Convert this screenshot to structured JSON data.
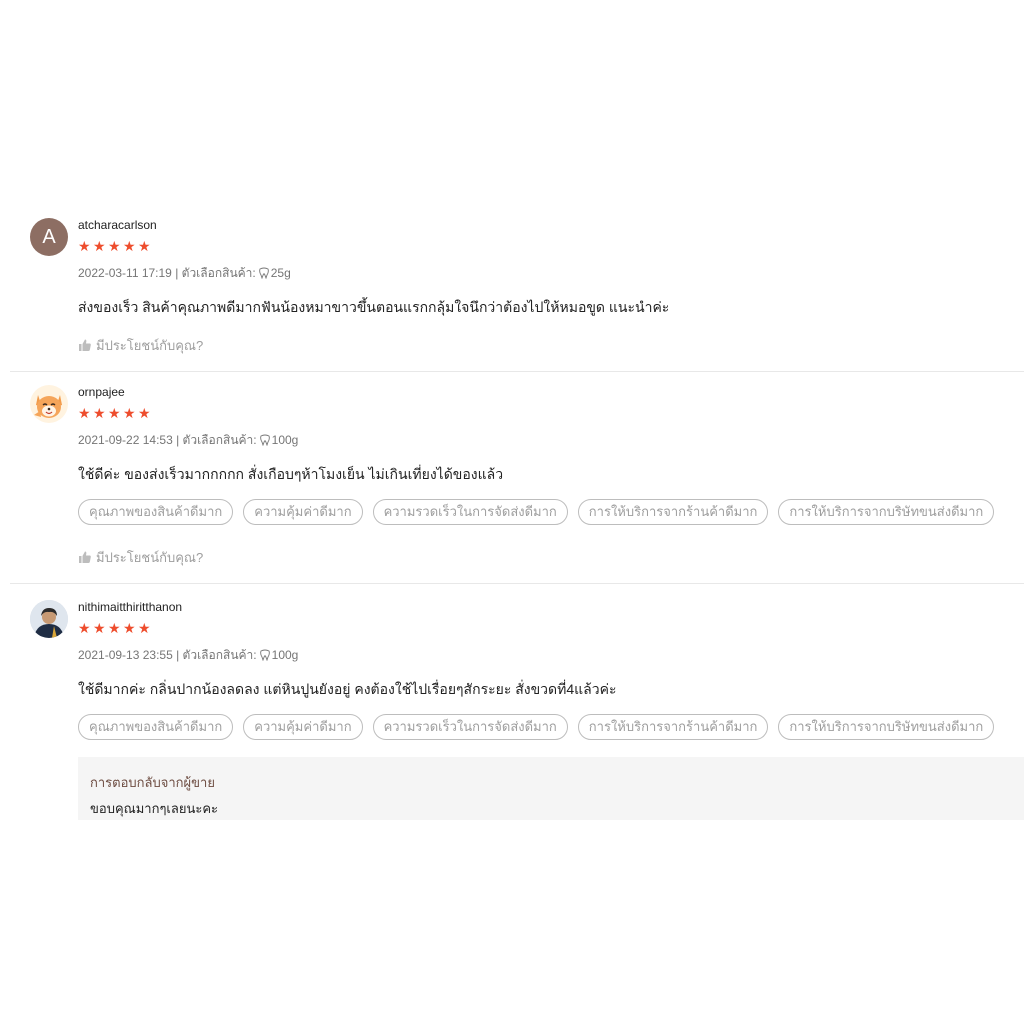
{
  "reviews": [
    {
      "avatar_letter": "A",
      "username": "atcharacarlson",
      "rating": 5,
      "date": "2022-03-11 17:19",
      "variation_label": "| ตัวเลือกสินค้า:",
      "variation_value": "25g",
      "comment": "ส่งของเร็ว สินค้าคุณภาพดีมากฟันน้องหมาขาวขึ้นตอนแรกกลุ้มใจนึกว่าต้องไปให้หมอขูด แนะนำค่ะ",
      "helpful": "มีประโยชน์กับคุณ?"
    },
    {
      "username": "ornpajee",
      "rating": 5,
      "date": "2021-09-22 14:53",
      "variation_label": "| ตัวเลือกสินค้า:",
      "variation_value": "100g",
      "comment": "ใช้ดีค่ะ ของส่งเร็วมากกกกก สั่งเกือบๆห้าโมงเย็น ไม่เกินเที่ยงได้ของแล้ว",
      "tags": [
        "คุณภาพของสินค้าดีมาก",
        "ความคุ้มค่าดีมาก",
        "ความรวดเร็วในการจัดส่งดีมาก",
        "การให้บริการจากร้านค้าดีมาก",
        "การให้บริการจากบริษัทขนส่งดีมาก"
      ],
      "helpful": "มีประโยชน์กับคุณ?"
    },
    {
      "username": "nithimaitthiritthanon",
      "rating": 5,
      "date": "2021-09-13 23:55",
      "variation_label": "| ตัวเลือกสินค้า:",
      "variation_value": "100g",
      "comment": "ใช้ดีมากค่ะ กลิ่นปากน้องลดลง แต่หินปูนยังอยู่ คงต้องใช้ไปเรื่อยๆสักระยะ สั่งขวดที่4แล้วค่ะ",
      "tags": [
        "คุณภาพของสินค้าดีมาก",
        "ความคุ้มค่าดีมาก",
        "ความรวดเร็วในการจัดส่งดีมาก",
        "การให้บริการจากร้านค้าดีมาก",
        "การให้บริการจากบริษัทขนส่งดีมาก"
      ],
      "seller_reply_title": "การตอบกลับจากผู้ขาย",
      "seller_reply": "ขอบคุณมากๆเลยนะคะ"
    }
  ],
  "colors": {
    "star": "#ee4d2d",
    "muted": "#757575",
    "border": "#e8e8e8",
    "reply_bg": "#f5f5f5"
  }
}
